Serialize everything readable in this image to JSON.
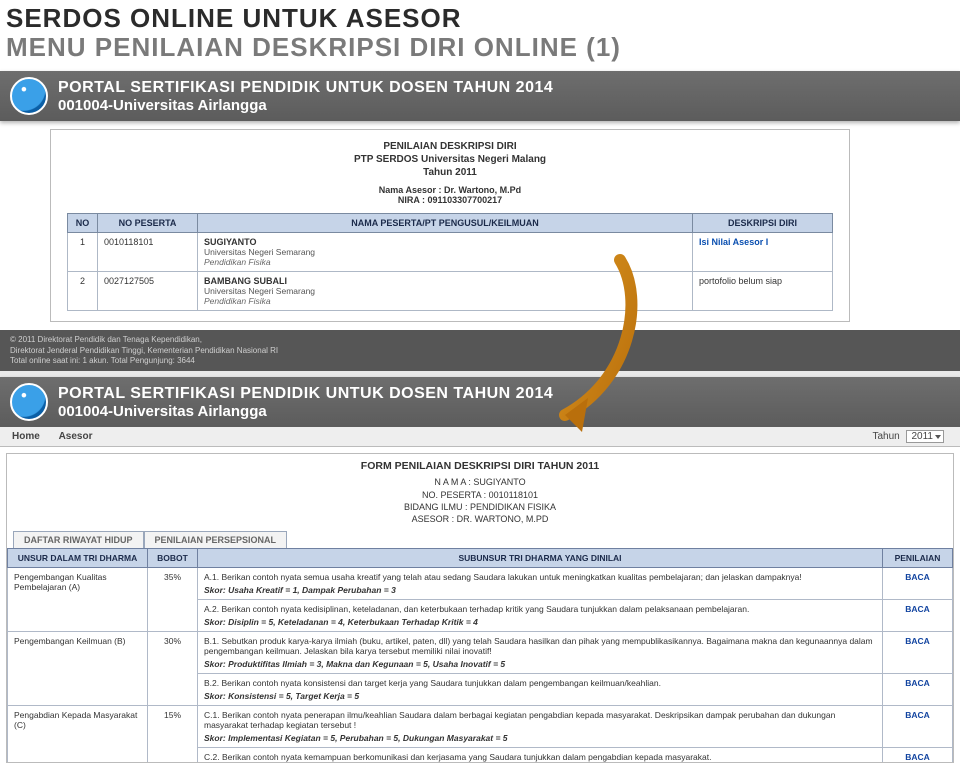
{
  "slide": {
    "line1": "SERDOS ONLINE UNTUK ASESOR",
    "line2": "MENU PENILAIAN DESKRIPSI DIRI ONLINE (1)"
  },
  "portal": {
    "title": "PORTAL SERTIFIKASI PENDIDIK UNTUK DOSEN TAHUN 2014",
    "subtitle": "001004-Universitas Airlangga"
  },
  "panel1": {
    "header": {
      "l1": "PENILAIAN DESKRIPSI DIRI",
      "l2": "PTP SERDOS Universitas Negeri Malang",
      "l3": "Tahun 2011"
    },
    "meta": {
      "nama_asesor_label": "Nama Asesor :",
      "nama_asesor": "Dr. Wartono, M.Pd",
      "nira_label": "NIRA :",
      "nira": "091103307700217"
    },
    "cols": {
      "no": "NO",
      "no_peserta": "NO PESERTA",
      "nama": "NAMA PESERTA/PT PENGUSUL/KEILMUAN",
      "deskripsi": "DESKRIPSI DIRI"
    },
    "rows": [
      {
        "no": "1",
        "no_peserta": "0010118101",
        "nama": "SUGIYANTO",
        "pt": "Universitas Negeri Semarang",
        "ilmu": "Pendidikan Fisika",
        "deskripsi": "Isi Nilai Asesor I",
        "link": true
      },
      {
        "no": "2",
        "no_peserta": "0027127505",
        "nama": "BAMBANG SUBALI",
        "pt": "Universitas Negeri Semarang",
        "ilmu": "Pendidikan Fisika",
        "deskripsi": "portofolio belum siap",
        "link": false
      }
    ],
    "footer": {
      "l1": "© 2011 Direktorat Pendidik dan Tenaga Kependidikan,",
      "l2": "Direktorat Jenderal Pendidikan Tinggi, Kementerian Pendidikan Nasional RI",
      "l3": "Total online saat ini: 1 akun. Total Pengunjung: 3644"
    }
  },
  "nav": {
    "home": "Home",
    "asesor": "Asesor",
    "tahun_label": "Tahun",
    "tahun_value": "2011"
  },
  "panel2": {
    "title": "FORM PENILAIAN DESKRIPSI DIRI TAHUN 2011",
    "meta": {
      "nama_label": "N A M A :",
      "nama": "SUGIYANTO",
      "no_peserta_label": "NO. PESERTA :",
      "no_peserta": "0010118101",
      "bidang_label": "BIDANG ILMU :",
      "bidang": "PENDIDIKAN FISIKA",
      "asesor_label": "ASESOR :",
      "asesor": "DR. WARTONO, M.PD"
    },
    "tabs": {
      "t1": "DAFTAR RIWAYAT HIDUP",
      "t2": "PENILAIAN PERSEPSIONAL"
    },
    "cols": {
      "unsur": "UNSUR DALAM TRI DHARMA",
      "bobot": "BOBOT",
      "subunsur": "SUBUNSUR TRI DHARMA YANG DINILAI",
      "penilaian": "PENILAIAN"
    },
    "baca": "BACA",
    "groups": [
      {
        "unsur": "Pengembangan Kualitas Pembelajaran (A)",
        "bobot": "35%",
        "subs": [
          {
            "q": "A.1. Berikan contoh nyata semua usaha kreatif yang telah atau sedang Saudara lakukan untuk meningkatkan kualitas pembelajaran; dan jelaskan dampaknya!",
            "skor": "Skor: Usaha Kreatif = 1, Dampak Perubahan = 3"
          },
          {
            "q": "A.2. Berikan contoh nyata kedisiplinan, keteladanan, dan keterbukaan terhadap kritik yang Saudara tunjukkan dalam pelaksanaan pembelajaran.",
            "skor": "Skor: Disiplin = 5, Keteladanan = 4, Keterbukaan Terhadap Kritik = 4"
          }
        ]
      },
      {
        "unsur": "Pengembangan Keilmuan (B)",
        "bobot": "30%",
        "subs": [
          {
            "q": "B.1. Sebutkan produk karya-karya ilmiah (buku, artikel, paten, dll) yang telah Saudara hasilkan dan pihak yang mempublikasikannya. Bagaimana makna dan kegunaannya dalam pengembangan keilmuan. Jelaskan bila karya tersebut memiliki nilai inovatif!",
            "skor": "Skor: Produktifitas Ilmiah = 3, Makna dan Kegunaan = 5, Usaha Inovatif = 5"
          },
          {
            "q": "B.2. Berikan contoh nyata konsistensi dan target kerja yang Saudara tunjukkan dalam pengembangan keilmuan/keahlian.",
            "skor": "Skor: Konsistensi = 5, Target Kerja = 5"
          }
        ]
      },
      {
        "unsur": "Pengabdian Kepada Masyarakat (C)",
        "bobot": "15%",
        "subs": [
          {
            "q": "C.1. Berikan contoh nyata penerapan ilmu/keahlian Saudara dalam berbagai kegiatan pengabdian kepada masyarakat. Deskripsikan dampak perubahan dan dukungan masyarakat terhadap kegiatan tersebut !",
            "skor": "Skor: Implementasi Kegiatan = 5, Perubahan = 5, Dukungan Masyarakat = 5"
          },
          {
            "q": "C.2. Berikan contoh nyata kemampuan berkomunikasi dan kerjasama yang Saudara tunjukkan dalam pengabdian kepada masyarakat.",
            "skor": ""
          }
        ]
      }
    ]
  }
}
